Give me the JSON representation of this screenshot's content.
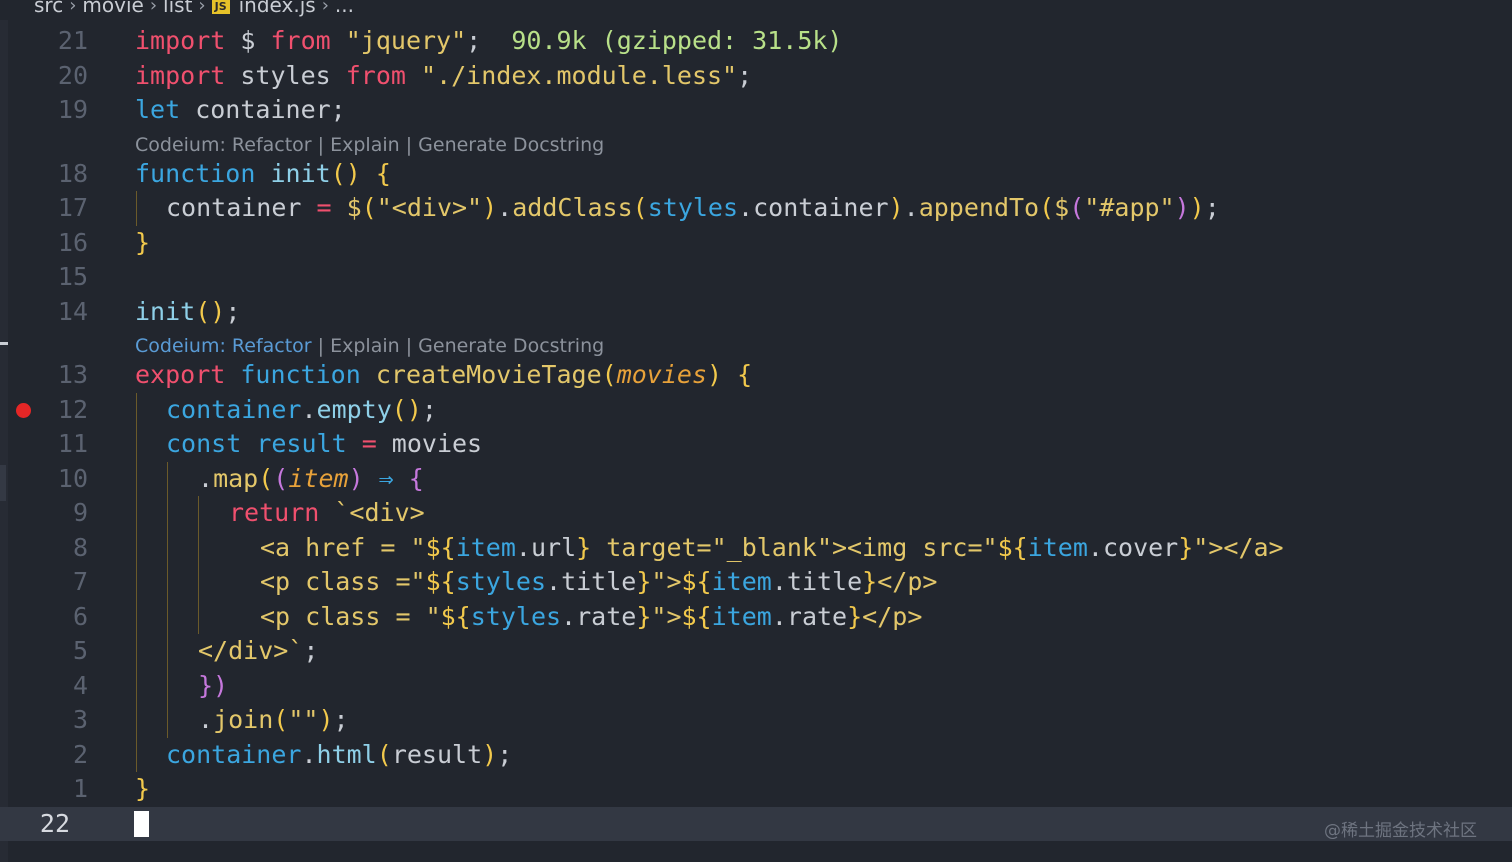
{
  "breadcrumb": {
    "items": [
      "src",
      "movie",
      "list"
    ],
    "file_badge": "JS",
    "file": "index.js",
    "more": "..."
  },
  "codelens": {
    "first": {
      "label": "Codeium: Refactor",
      "sep1": " | ",
      "explain": "Explain",
      "sep2": " | ",
      "docstring": "Generate Docstring"
    },
    "second": {
      "label": "Codeium: Refactor",
      "sep1": " | ",
      "explain": "Explain",
      "sep2": " | ",
      "docstring": "Generate Docstring"
    }
  },
  "import_size": "90.9k (gzipped: 31.5k)",
  "line_numbers": [
    "21",
    "20",
    "19",
    "18",
    "17",
    "16",
    "15",
    "14",
    "13",
    "12",
    "11",
    "10",
    "9",
    "8",
    "7",
    "6",
    "5",
    "4",
    "3",
    "2",
    "1",
    "22"
  ],
  "code": {
    "l21": [
      "import",
      " $ ",
      "from",
      " ",
      "\"jquery\"",
      ";"
    ],
    "l20": [
      "import",
      " styles ",
      "from",
      " ",
      "\"./index.module.less\"",
      ";"
    ],
    "l19": [
      "let",
      " container;"
    ],
    "l18": [
      "function",
      " ",
      "init",
      "()",
      " ",
      "{"
    ],
    "l17": [
      "container",
      " = ",
      "$",
      "(",
      "\"<div>\"",
      ")",
      ".",
      "addClass",
      "(",
      "styles",
      ".",
      "container",
      ")",
      ".",
      "appendTo",
      "(",
      "$",
      "(",
      "\"#app\"",
      ")",
      ")",
      ";"
    ],
    "l16": [
      "}"
    ],
    "l14": [
      "init",
      "()",
      ";"
    ],
    "l13": [
      "export",
      " ",
      "function",
      " ",
      "createMovieTage",
      "(",
      "movies",
      ")",
      " ",
      "{"
    ],
    "l12": [
      "container",
      ".",
      "empty",
      "()",
      ";"
    ],
    "l11": [
      "const",
      " ",
      "result",
      " = ",
      "movies"
    ],
    "l10": [
      ".",
      "map",
      "(",
      "(",
      "item",
      ")",
      " ⇒ ",
      "{"
    ],
    "l9": [
      "return",
      " ",
      "`<div>"
    ],
    "l8": [
      "<a href = \"",
      "${",
      "item",
      ".",
      "url",
      "}",
      " target=\"_blank\"><img src=\"",
      "${",
      "item",
      ".",
      "cover",
      "}",
      "\"></a>"
    ],
    "l7": [
      "<p class =\"",
      "${",
      "styles",
      ".",
      "title",
      "}",
      "\">",
      "${",
      "item",
      ".",
      "title",
      "}",
      "</p>"
    ],
    "l6": [
      "<p class = \"",
      "${",
      "styles",
      ".",
      "rate",
      "}",
      "\">",
      "${",
      "item",
      ".",
      "rate",
      "}",
      "</p>"
    ],
    "l5": [
      "</div>`",
      ";"
    ],
    "l4": [
      "})"
    ],
    "l3": [
      ".",
      "join",
      "(",
      "\"\"",
      ")",
      ";"
    ],
    "l2": [
      "container",
      ".",
      "html",
      "(",
      "result",
      ")",
      ";"
    ],
    "l1": [
      "}"
    ]
  },
  "watermark": "@稀土掘金技术社区",
  "colors": {
    "background": "#22262e",
    "keyword": "#f0506e",
    "identifier": "#3ba6e0",
    "string": "#e3c76a",
    "bracket": "#f2c94c",
    "breakpoint": "#e52626"
  }
}
